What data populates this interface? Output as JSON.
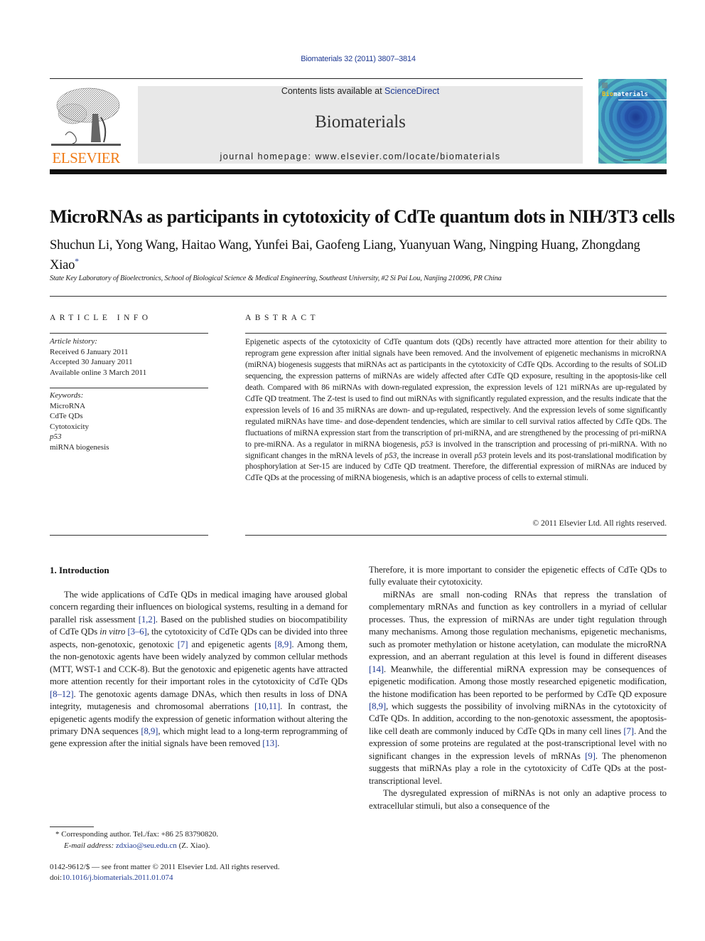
{
  "journal_ref": "Biomaterials 32 (2011) 3807–3814",
  "header": {
    "publisher_logo_text": "ELSEVIER",
    "contents_prefix": "Contents lists available at ",
    "contents_link": "ScienceDirect",
    "journal_name": "Biomaterials",
    "homepage_prefix": "journal homepage: ",
    "homepage_url": "www.elsevier.com/locate/biomaterials",
    "cover_title_bio": "Bio",
    "cover_title_rest": "materials"
  },
  "article": {
    "title": "MicroRNAs as participants in cytotoxicity of CdTe quantum dots in NIH/3T3 cells",
    "authors": "Shuchun Li, Yong Wang, Haitao Wang, Yunfei Bai, Gaofeng Liang, Yuanyuan Wang, Ningping Huang, Zhongdang Xiao",
    "corresponding_mark": "*",
    "affiliation": "State Key Laboratory of Bioelectronics, School of Biological Science & Medical Engineering, Southeast University, #2 Si Pai Lou, Nanjing 210096, PR China"
  },
  "article_info": {
    "heading": "ARTICLE INFO",
    "history_label": "Article history:",
    "history": [
      "Received 6 January 2011",
      "Accepted 30 January 2011",
      "Available online 3 March 2011"
    ],
    "keywords_label": "Keywords:",
    "keywords": [
      "MicroRNA",
      "CdTe QDs",
      "Cytotoxicity",
      "p53",
      "miRNA biogenesis"
    ]
  },
  "abstract": {
    "heading": "ABSTRACT",
    "p1": "Epigenetic aspects of the cytotoxicity of CdTe quantum dots (QDs) recently have attracted more attention for their ability to reprogram gene expression after initial signals have been removed. And the involvement of epigenetic mechanisms in microRNA (miRNA) biogenesis suggests that miRNAs act as participants in the cytotoxicity of CdTe QDs. According to the results of SOLiD sequencing, the expression patterns of miRNAs are widely affected after CdTe QD exposure, resulting in the apoptosis-like cell death. Compared with 86 miRNAs with down-regulated expression, the expression levels of 121 miRNAs are up-regulated by CdTe QD treatment. The Z-test is used to find out miRNAs with significantly regulated expression, and the results indicate that the expression levels of 16 and 35 miRNAs are down- and up-regulated, respectively. And the expression levels of some significantly regulated miRNAs have time- and dose-dependent tendencies, which are similar to cell survival ratios affected by CdTe QDs. The fluctuations of miRNA expression start from the transcription of pri-miRNA, and are strengthened by the processing of pri-miRNA to pre-miRNA. As a regulator in miRNA biogenesis, ",
    "p53_a": "p53",
    "p2": " is involved in the transcription and processing of pri-miRNA. With no significant changes in the mRNA levels of ",
    "p53_b": "p53",
    "p3": ", the increase in overall ",
    "p53_c": "p53",
    "p4": " protein levels and its post-translational modification by phosphorylation at Ser-15 are induced by CdTe QD treatment. Therefore, the differential expression of miRNAs are induced by CdTe QDs at the processing of miRNA biogenesis, which is an adaptive process of cells to external stimuli.",
    "copyright": "© 2011 Elsevier Ltd. All rights reserved."
  },
  "body": {
    "section_heading": "1.  Introduction",
    "left": {
      "s1": "The wide applications of CdTe QDs in medical imaging have aroused global concern regarding their influences on biological systems, resulting in a demand for parallel risk assessment ",
      "r1": "[1,2]",
      "s2": ". Based on the published studies on biocompatibility of CdTe QDs ",
      "invitro": "in vitro",
      "s3": " ",
      "r2": "[3–6]",
      "s4": ", the cytotoxicity of CdTe QDs can be divided into three aspects, non-genotoxic, genotoxic ",
      "r3": "[7]",
      "s5": " and epigenetic agents ",
      "r4": "[8,9]",
      "s6": ". Among them, the non-genotoxic agents have been widely analyzed by common cellular methods (MTT, WST-1 and CCK-8). But the genotoxic and epigenetic agents have attracted more attention recently for their important roles in the cytotoxicity of CdTe QDs ",
      "r5": "[8–12]",
      "s7": ". The genotoxic agents damage DNAs, which then results in loss of DNA integrity, mutagenesis and chromosomal aberrations ",
      "r6": "[10,11]",
      "s8": ". In contrast, the epigenetic agents modify the expression of genetic information without altering the primary DNA sequences ",
      "r7": "[8,9]",
      "s9": ", which might lead to a long-term reprogramming of gene expression after the initial signals have been removed ",
      "r8": "[13]",
      "s10": "."
    },
    "right": {
      "p1": "Therefore, it is more important to consider the epigenetic effects of CdTe QDs to fully evaluate their cytotoxicity.",
      "p2_s1": "miRNAs are small non-coding RNAs that repress the translation of complementary mRNAs and function as key controllers in a myriad of cellular processes. Thus, the expression of miRNAs are under tight regulation through many mechanisms. Among those regulation mechanisms, epigenetic mechanisms, such as promoter methylation or histone acetylation, can modulate the microRNA expression, and an aberrant regulation at this level is found in different diseases ",
      "p2_r1": "[14]",
      "p2_s2": ". Meanwhile, the differential miRNA expression may be consequences of epigenetic modification. Among those mostly researched epigenetic modification, the histone modification has been reported to be performed by CdTe QD exposure ",
      "p2_r2": "[8,9]",
      "p2_s3": ", which suggests the possibility of involving miRNAs in the cytotoxicity of CdTe QDs. In addition, according to the non-genotoxic assessment, the apoptosis-like cell death are commonly induced by CdTe QDs in many cell lines ",
      "p2_r3": "[7]",
      "p2_s4": ". And the expression of some proteins are regulated at the post-transcriptional level with no significant changes in the expression levels of mRNAs ",
      "p2_r4": "[9]",
      "p2_s5": ". The phenomenon suggests that miRNAs play a role in the cytotoxicity of CdTe QDs at the post-transcriptional level.",
      "p3": "The dysregulated expression of miRNAs is not only an adaptive process to extracellular stimuli, but also a consequence of the"
    }
  },
  "footnote": {
    "mark": "*",
    "corresponding": " Corresponding author. Tel./fax: +86 25 83790820.",
    "email_label": "E-mail address:",
    "email": "zdxiao@seu.edu.cn",
    "email_suffix": " (Z. Xiao)."
  },
  "front_matter": {
    "line1": "0142-9612/$ — see front matter © 2011 Elsevier Ltd. All rights reserved.",
    "doi_label": "doi:",
    "doi": "10.1016/j.biomaterials.2011.01.074"
  }
}
